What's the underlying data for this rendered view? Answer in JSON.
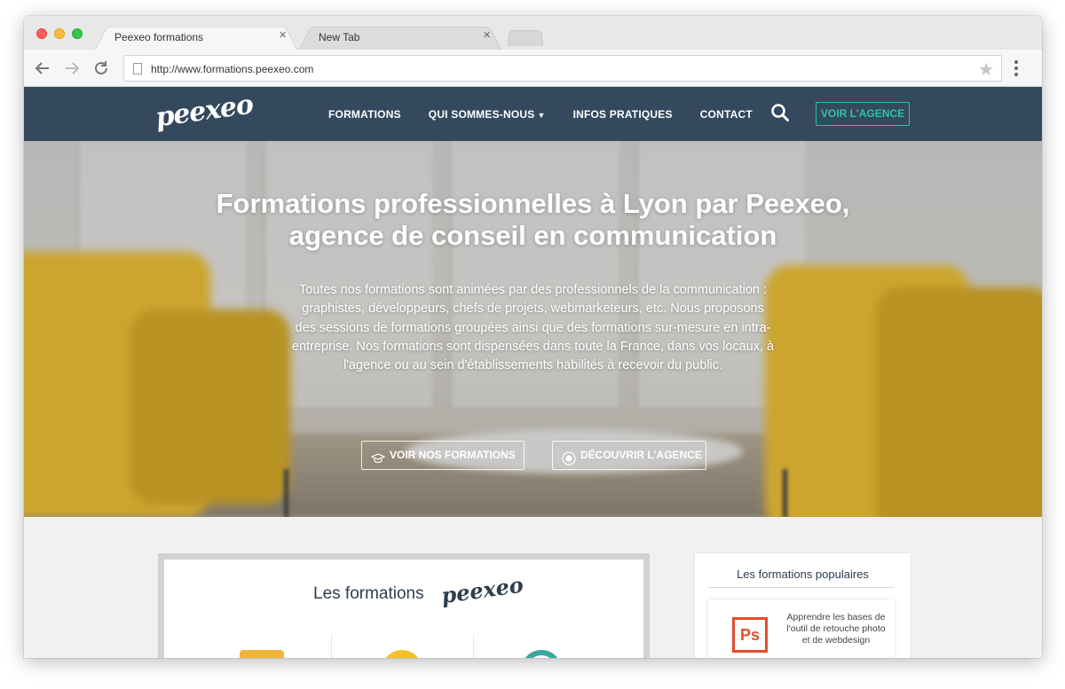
{
  "browser": {
    "tabs": [
      {
        "title": "Peexeo formations",
        "close": "×"
      },
      {
        "title": "New Tab",
        "close": "×"
      }
    ],
    "url": "http://www.formations.peexeo.com",
    "star": "★"
  },
  "site": {
    "logo": "peexeo",
    "nav": {
      "items": [
        "FORMATIONS",
        "QUI SOMMES-NOUS",
        "INFOS PRATIQUES",
        "CONTACT"
      ],
      "dropdown_caret": "▼",
      "cta": "VOIR L'AGENCE"
    },
    "hero": {
      "title_line1": "Formations professionnelles à Lyon par Peexeo,",
      "title_line2": "agence de conseil en communication",
      "text": "Toutes nos formations sont animées par des professionnels de la communication : graphistes, développeurs, chefs de projets, webmarketeurs, etc. Nous proposons des sessions de formations groupées ainsi que des formations sur-mesure en intra-entreprise. Nos formations sont dispensées dans toute la France, dans vos locaux, à l'agence ou au sein d'établissements habilités à recevoir du public.",
      "btn_primary": "VOIR NOS FORMATIONS",
      "btn_secondary": "DÉCOUVRIR L'AGENCE"
    },
    "formations_card": {
      "title": "Les formations",
      "logo": "peexeo"
    },
    "popular": {
      "title": "Les formations populaires",
      "items": [
        {
          "icon_text": "Ps",
          "label": "Apprendre les bases de l'outil de retouche photo et de webdesign"
        }
      ]
    },
    "colors": {
      "nav_bg": "#34495e",
      "accent": "#2dc3a7",
      "chair_yellow": "#f2c12a",
      "ps_orange": "#e04e2b"
    }
  }
}
